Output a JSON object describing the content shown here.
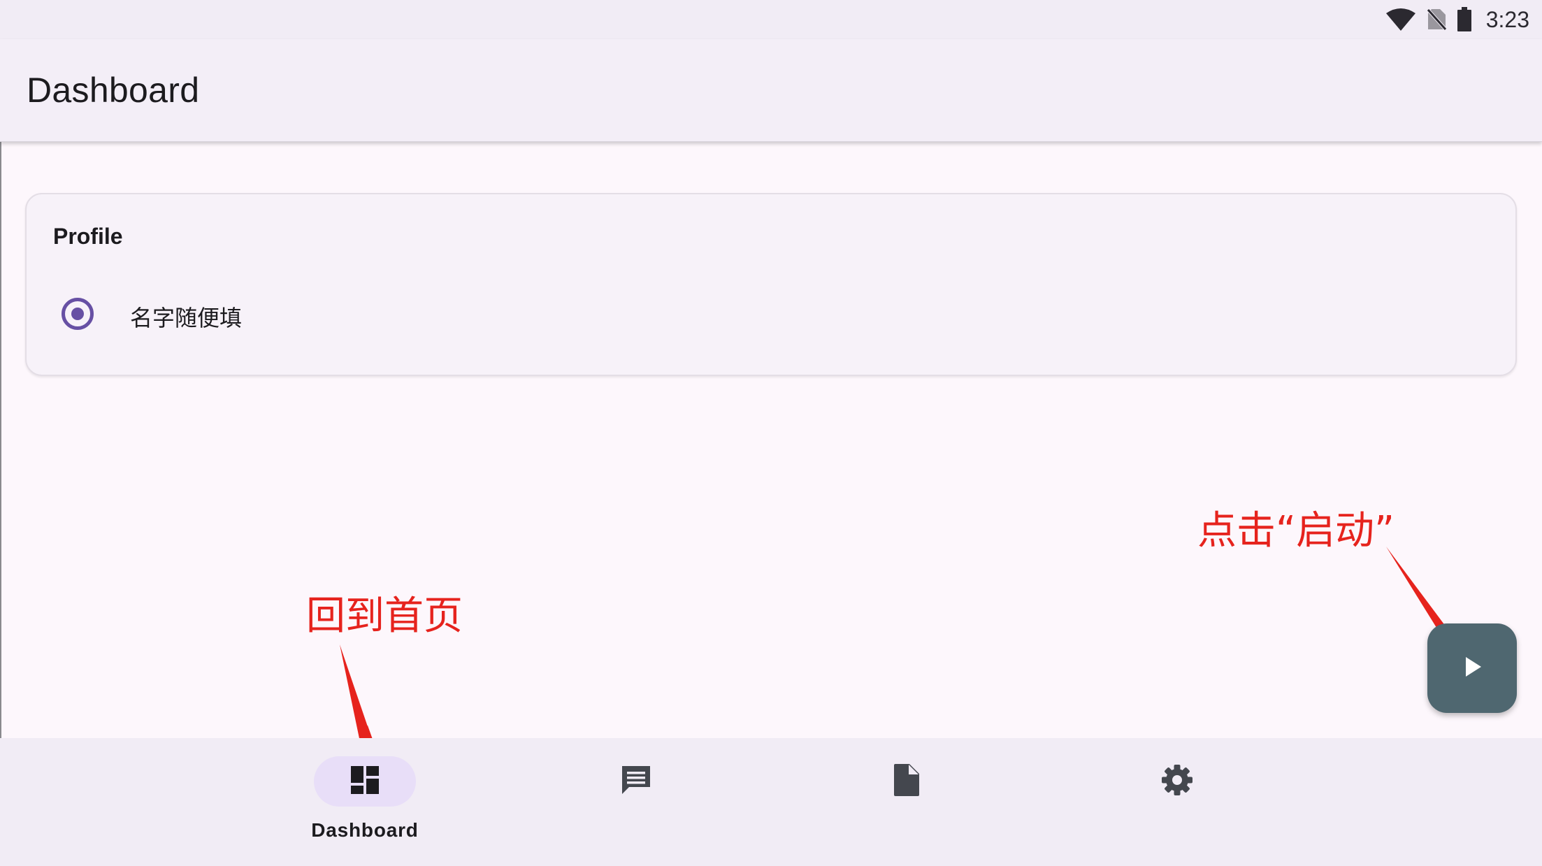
{
  "status_bar": {
    "time": "3:23",
    "icons": [
      "wifi-icon",
      "no-sim-icon",
      "battery-icon"
    ]
  },
  "app_bar": {
    "title": "Dashboard"
  },
  "profile_card": {
    "title": "Profile",
    "items": [
      {
        "label": "名字随便填",
        "selected": true
      }
    ]
  },
  "annotations": {
    "home_hint": "回到首页",
    "start_hint": "点击“启动”"
  },
  "fab": {
    "icon": "play-icon"
  },
  "bottom_nav": {
    "items": [
      {
        "icon": "dashboard-icon",
        "label": "Dashboard",
        "active": true
      },
      {
        "icon": "message-icon",
        "label": "",
        "active": false
      },
      {
        "icon": "document-icon",
        "label": "",
        "active": false
      },
      {
        "icon": "settings-icon",
        "label": "",
        "active": false
      }
    ]
  },
  "colors": {
    "primary": "#6750a4",
    "fab": "#4f6770",
    "annotation": "#e6231d",
    "nav_indicator": "#e8def8"
  }
}
